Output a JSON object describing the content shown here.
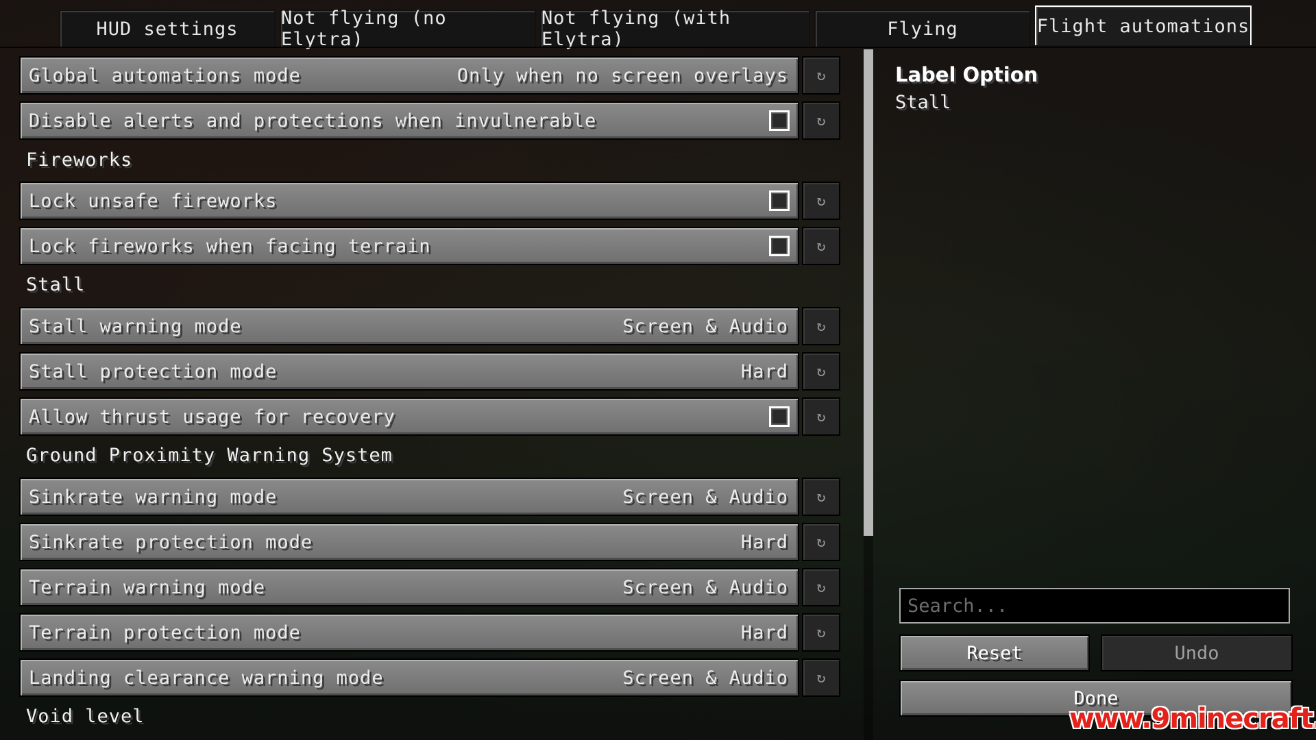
{
  "tabs": [
    {
      "label": "HUD settings"
    },
    {
      "label": "Not flying (no Elytra)"
    },
    {
      "label": "Not flying (with Elytra)"
    },
    {
      "label": "Flying"
    },
    {
      "label": "Flight automations"
    }
  ],
  "active_tab": "Flight automations",
  "rows": {
    "global_mode": {
      "label": "Global automations mode",
      "value": "Only when no screen overlays"
    },
    "disable_alerts": {
      "label": "Disable alerts and protections when invulnerable",
      "checked": false
    },
    "section_fireworks": "Fireworks",
    "lock_unsafe": {
      "label": "Lock unsafe fireworks",
      "checked": false
    },
    "lock_terrain": {
      "label": "Lock fireworks when facing terrain",
      "checked": false
    },
    "section_stall": "Stall",
    "stall_warning": {
      "label": "Stall warning mode",
      "value": "Screen & Audio"
    },
    "stall_protection": {
      "label": "Stall protection mode",
      "value": "Hard"
    },
    "thrust_recovery": {
      "label": "Allow thrust usage for recovery",
      "checked": false
    },
    "section_gpws": "Ground Proximity Warning System",
    "sinkrate_warning": {
      "label": "Sinkrate warning mode",
      "value": "Screen & Audio"
    },
    "sinkrate_protection": {
      "label": "Sinkrate protection mode",
      "value": "Hard"
    },
    "terrain_warning": {
      "label": "Terrain warning mode",
      "value": "Screen & Audio"
    },
    "terrain_protection": {
      "label": "Terrain protection mode",
      "value": "Hard"
    },
    "landing_warning": {
      "label": "Landing clearance warning mode",
      "value": "Screen & Audio"
    },
    "section_void": "Void level"
  },
  "reset_icon": "↻",
  "panel": {
    "title": "Label Option",
    "subtitle": "Stall"
  },
  "search": {
    "placeholder": "Search..."
  },
  "buttons": {
    "reset": "Reset",
    "undo": "Undo",
    "done": "Done"
  },
  "watermark": "www.9minecraft.net"
}
